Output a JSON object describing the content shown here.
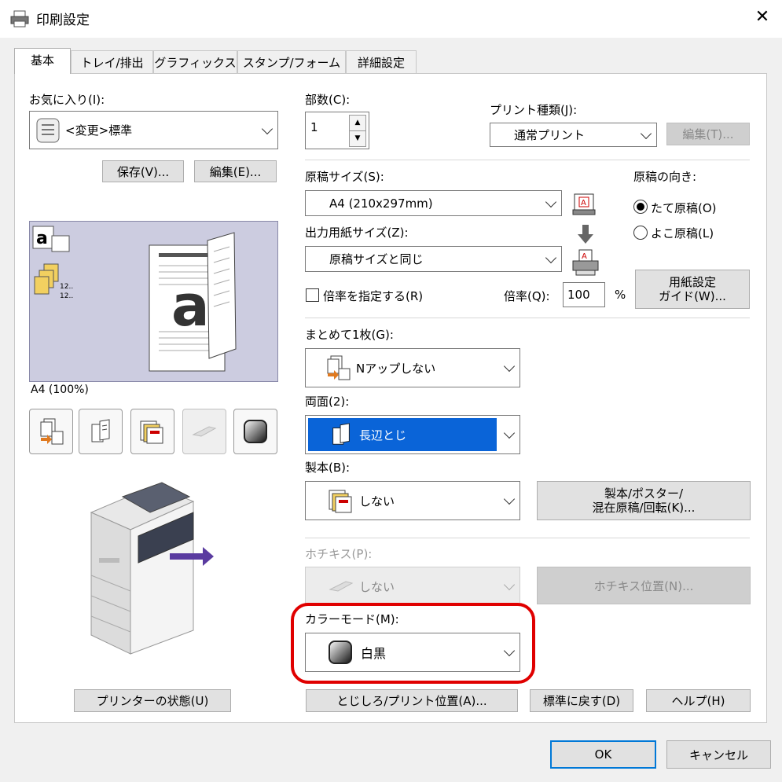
{
  "window": {
    "title": "印刷設定",
    "close": "✕"
  },
  "tabs": [
    "基本",
    "トレイ/排出",
    "グラフィックス",
    "スタンプ/フォーム",
    "詳細設定"
  ],
  "favorites": {
    "label": "お気に入り(I):",
    "value": "<変更>標準",
    "save": "保存(V)...",
    "edit": "編集(E)..."
  },
  "preview": {
    "caption": "A4 (100%)",
    "mini_text1": "12..",
    "mini_text2": "12.."
  },
  "printer_status": "プリンターの状態(U)",
  "copies": {
    "label": "部数(C):",
    "value": "1"
  },
  "print_type": {
    "label": "プリント種類(J):",
    "value": "通常プリント",
    "edit": "編集(T)..."
  },
  "original_size": {
    "label": "原稿サイズ(S):",
    "value": "A4 (210x297mm)"
  },
  "output_size": {
    "label": "出力用紙サイズ(Z):",
    "value": "原稿サイズと同じ"
  },
  "orientation": {
    "label": "原稿の向き:",
    "portrait": "たて原稿(O)",
    "landscape": "よこ原稿(L)",
    "selected": "portrait"
  },
  "scale": {
    "check_label": "倍率を指定する(R)",
    "label": "倍率(Q):",
    "value": "100",
    "unit": "%"
  },
  "paper_guide": {
    "line1": "用紙設定",
    "line2": "ガイド(W)..."
  },
  "nup": {
    "label": "まとめて1枚(G):",
    "value": "Nアップしない"
  },
  "duplex": {
    "label": "両面(2):",
    "value": "長辺とじ"
  },
  "binding": {
    "label": "製本(B):",
    "value": "しない",
    "button_line1": "製本/ポスター/",
    "button_line2": "混在原稿/回転(K)..."
  },
  "staple": {
    "label": "ホチキス(P):",
    "value": "しない",
    "button": "ホチキス位置(N)..."
  },
  "color_mode": {
    "label": "カラーモード(M):",
    "value": "白黒",
    "highlight_color": "#e00000"
  },
  "bottom": {
    "margin": "とじしろ/プリント位置(A)...",
    "defaults": "標準に戻す(D)",
    "help": "ヘルプ(H)"
  },
  "footer": {
    "ok": "OK",
    "cancel": "キャンセル"
  },
  "colors": {
    "accent": "#0078d7",
    "preview_bg": "#cccce0",
    "selection": "#0a64d8"
  }
}
